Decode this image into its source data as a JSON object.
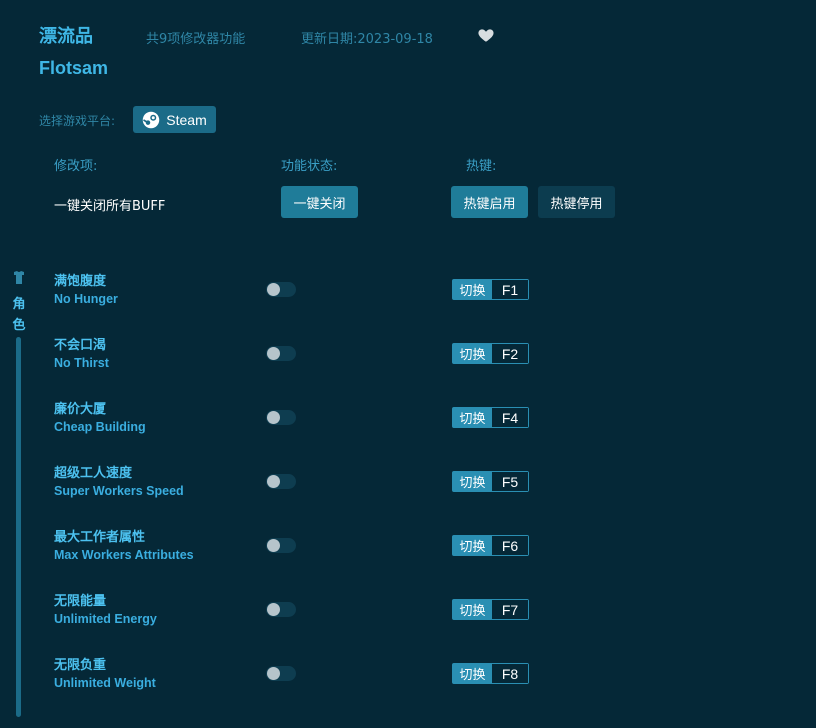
{
  "header": {
    "title_cn": "漂流品",
    "feature_count": "共9项修改器功能",
    "update_date": "更新日期:2023-09-18",
    "title_en": "Flotsam",
    "favorite_icon": "heart-icon"
  },
  "platform": {
    "label": "选择游戏平台:",
    "steam_label": "Steam",
    "steam_icon": "steam-icon"
  },
  "columns": {
    "mod": "修改项:",
    "status": "功能状态:",
    "hotkey": "热键:"
  },
  "global": {
    "label": "一键关闭所有BUFF",
    "close_all": "一键关闭",
    "hotkey_enable": "热键启用",
    "hotkey_disable": "热键停用"
  },
  "sidebar": {
    "category_icon": "character-icon",
    "category_label": "角色"
  },
  "colors": {
    "background": "#052837",
    "accent": "#3fb7e6",
    "button": "#1f7c99"
  },
  "items": [
    {
      "cn": "满饱腹度",
      "en": "No Hunger",
      "switch_label": "切换",
      "key": "F1",
      "enabled": false
    },
    {
      "cn": "不会口渴",
      "en": "No Thirst",
      "switch_label": "切换",
      "key": "F2",
      "enabled": false
    },
    {
      "cn": "廉价大厦",
      "en": "Cheap Building",
      "switch_label": "切换",
      "key": "F4",
      "enabled": false
    },
    {
      "cn": "超级工人速度",
      "en": "Super Workers Speed",
      "switch_label": "切换",
      "key": "F5",
      "enabled": false
    },
    {
      "cn": "最大工作者属性",
      "en": "Max Workers Attributes",
      "switch_label": "切换",
      "key": "F6",
      "enabled": false
    },
    {
      "cn": "无限能量",
      "en": "Unlimited Energy",
      "switch_label": "切换",
      "key": "F7",
      "enabled": false
    },
    {
      "cn": "无限负重",
      "en": "Unlimited Weight",
      "switch_label": "切换",
      "key": "F8",
      "enabled": false
    }
  ]
}
